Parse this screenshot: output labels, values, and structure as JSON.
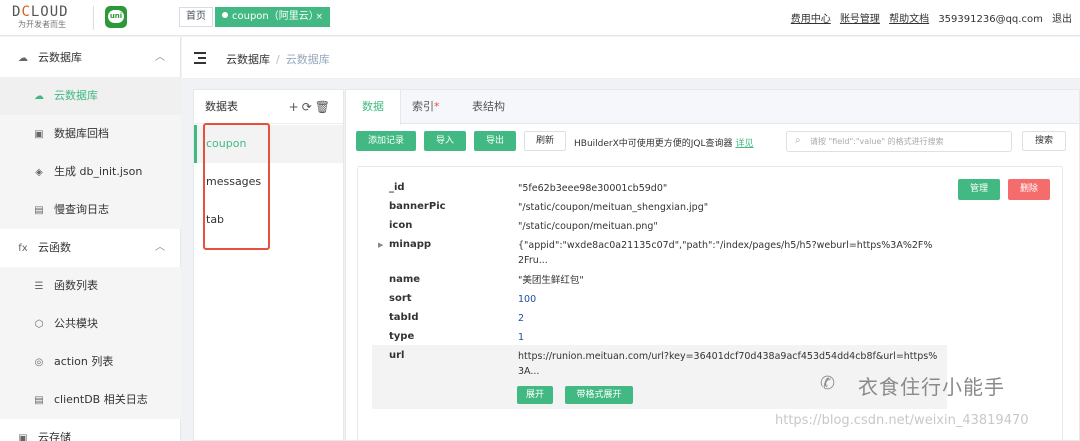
{
  "topbar": {
    "logo_main": "DCLOUD",
    "logo_sub": "为开发者而生",
    "uni_logo_text": "uni",
    "tabs": [
      {
        "label": "首页"
      },
      {
        "label": "coupon（阿里云）",
        "close": "×"
      }
    ],
    "links": [
      "费用中心",
      "账号管理",
      "帮助文档"
    ],
    "account": "359391236@qq.com",
    "logout": "退出"
  },
  "sidebar": {
    "groups": [
      {
        "label": "云数据库",
        "icon": "cloud-db-icon",
        "chevron": "︿"
      },
      {
        "label": "云函数",
        "icon": "fx-icon",
        "chevron": "︿"
      },
      {
        "label": "云存储",
        "icon": "storage-icon"
      }
    ],
    "db_items": [
      {
        "label": "云数据库",
        "icon": "cloud-db-icon"
      },
      {
        "label": "数据库回档",
        "icon": "rollback-icon"
      },
      {
        "label": "生成 db_init.json",
        "icon": "generate-icon"
      },
      {
        "label": "慢查询日志",
        "icon": "log-icon"
      }
    ],
    "fn_items": [
      {
        "label": "函数列表",
        "icon": "list-icon"
      },
      {
        "label": "公共模块",
        "icon": "module-icon"
      },
      {
        "label": "action 列表",
        "icon": "action-icon"
      },
      {
        "label": "clientDB 相关日志",
        "icon": "log-icon"
      }
    ],
    "fx_glyph": "fx"
  },
  "breadcrumb": {
    "items": [
      "云数据库",
      "云数据库"
    ],
    "sep": "/"
  },
  "collections": {
    "title": "数据表",
    "items": [
      "coupon",
      "messages",
      "tab"
    ]
  },
  "data_tabs": [
    {
      "label": "数据"
    },
    {
      "label": "索引",
      "star": "*"
    },
    {
      "label": "表结构"
    }
  ],
  "toolbar": {
    "add": "添加记录",
    "import": "导入",
    "export": "导出",
    "refresh": "刷新",
    "hint": "HBuilderX中可使用更方便的JQL查询器",
    "hint_link": "详见",
    "search_placeholder": "请按 \"field\":\"value\" 的格式进行搜索",
    "search_button": "搜索"
  },
  "record": {
    "manage": "管理",
    "delete": "删除",
    "fields": [
      {
        "key": "_id",
        "value": "\"5fe62b3eee98e30001cb59d0\""
      },
      {
        "key": "bannerPic",
        "value": "\"/static/coupon/meituan_shengxian.jpg\""
      },
      {
        "key": "icon",
        "value": "\"/static/coupon/meituan.png\""
      },
      {
        "key": "minapp",
        "value": "{\"appid\":\"wxde8ac0a21135c07d\",\"path\":\"/index/pages/h5/h5?weburl=https%3A%2F%2Fru..."
      },
      {
        "key": "name",
        "value": "\"美团生鲜红包\""
      },
      {
        "key": "sort",
        "value": "100"
      },
      {
        "key": "tabId",
        "value": "2"
      },
      {
        "key": "type",
        "value": "1"
      },
      {
        "key": "url",
        "value": "https://runion.meituan.com/url?key=36401dcf70d438a9acf453d54dd4cb8f&url=https%3A..."
      }
    ],
    "expand": "展开",
    "format_expand": "带格式展开"
  },
  "watermark": {
    "title": "衣食住行小能手",
    "url": "https://blog.csdn.net/weixin_43819470"
  },
  "colors": {
    "accent": "#42b983",
    "danger": "#f56c6c",
    "highlight_box": "#e5513a"
  }
}
